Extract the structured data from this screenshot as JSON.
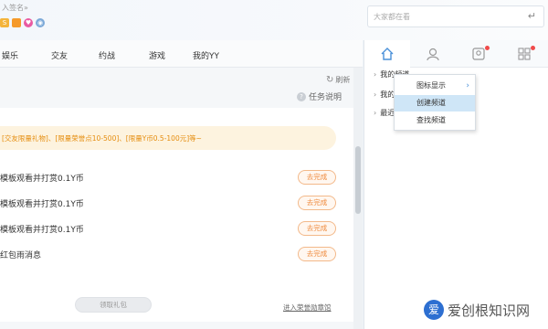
{
  "header": {
    "signature": "入签名»",
    "badges": [
      "S",
      "",
      "",
      ""
    ],
    "search_placeholder": "大家都在看",
    "enter_icon": "enter-icon"
  },
  "nav": {
    "items": [
      "娱乐",
      "交友",
      "约战",
      "游戏",
      "我的YY"
    ]
  },
  "main": {
    "refresh_label": "刷新",
    "task_explain": "任务说明",
    "notice": "[交友限量礼物]、[限量荣誉点10-500]、[限量Y币0.5-100元]等~",
    "tasks": [
      {
        "text": "模板观看并打赏0.1Y币",
        "action": "去完成"
      },
      {
        "text": "模板观看并打赏0.1Y币",
        "action": "去完成"
      },
      {
        "text": "模板观看并打赏0.1Y币",
        "action": "去完成"
      },
      {
        "text": "红包雨消息",
        "action": "去完成"
      }
    ],
    "claim_button": "领取礼包",
    "view_more": "进入荣誉勋章馆"
  },
  "right": {
    "tabs": [
      "home-icon",
      "contact-icon",
      "friend-icon",
      "apps-icon"
    ],
    "tree": [
      "我的频道",
      "我的",
      "最近"
    ],
    "context_menu": [
      "图标显示",
      "创建频道",
      "查找频道"
    ]
  },
  "watermark": {
    "text": "爱创根知识网",
    "logo": "爱"
  },
  "colors": {
    "accent": "#4a90d9",
    "task_orange": "#ef8a3c",
    "notice_bg": "#fdf3df",
    "menu_highlight": "#cfe6f7"
  }
}
